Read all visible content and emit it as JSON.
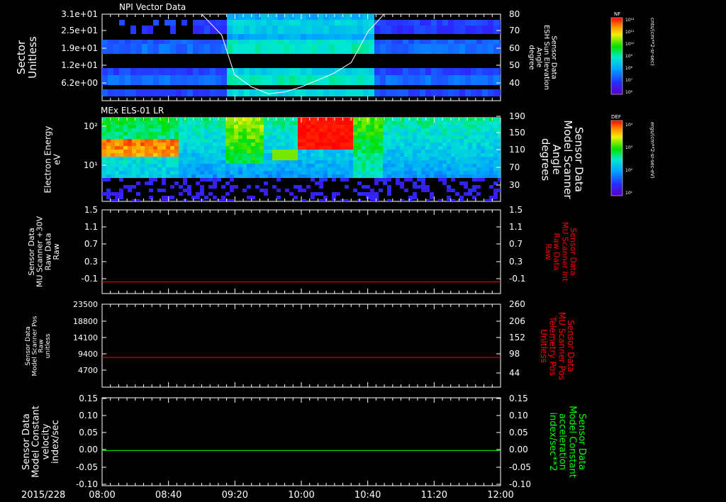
{
  "chart_data": [
    {
      "type": "heatmap",
      "title": "NPI Vector Data",
      "ylabel": [
        "Sector",
        "Unitless"
      ],
      "yticks": [
        "3.1e+01",
        "2.5e+01",
        "1.9e+01",
        "1.2e+01",
        "6.2e+00"
      ],
      "y2label": [
        "Sensor Data",
        "ESH Sun Elevation",
        "Angle",
        "degree"
      ],
      "y2lim": [
        30,
        80
      ],
      "y2ticks": [
        "40",
        "50",
        "60",
        "70",
        "80"
      ],
      "colorbar": {
        "label": "NF",
        "units": "cnts/(cm**2-sr-sec)",
        "ticks": [
          "10¹²",
          "10¹¹",
          "10¹⁰",
          "10⁹",
          "10⁸",
          "10⁷",
          "10⁶"
        ]
      },
      "series": [
        {
          "x": [
            8.0,
            8.33,
            8.67,
            9.0,
            9.2,
            9.33,
            9.5,
            9.67,
            9.83,
            10.0,
            10.17,
            10.33,
            10.5,
            10.67,
            10.83,
            11.0,
            11.5,
            12.0
          ],
          "y": [
            80,
            80,
            80,
            80,
            68,
            45,
            38,
            34,
            35,
            38,
            42,
            46,
            52,
            70,
            80,
            80,
            80,
            80
          ]
        }
      ]
    },
    {
      "type": "heatmap",
      "title": "MEx ELS-01 LR",
      "ylabel": [
        "Electron Energy",
        "eV"
      ],
      "yticks": [
        "10²",
        "10¹"
      ],
      "y2label": [
        "Sensor Data",
        "Model Scanner",
        "Angle",
        "degrees"
      ],
      "y2lim": [
        10,
        190
      ],
      "y2ticks": [
        "30",
        "70",
        "110",
        "150",
        "190"
      ],
      "colorbar": {
        "label": "DEF",
        "units": "ergs/(cm**2-sr-sec-eV)",
        "ticks": [
          "10⁴",
          "10³",
          "10²",
          "10¹"
        ]
      }
    },
    {
      "type": "line",
      "ylabel": [
        "Sensor Data",
        "MU Scanner +30V",
        "Raw Data",
        "Raw"
      ],
      "ylim": [
        -0.3,
        1.5
      ],
      "yticks": [
        "1.5",
        "1.1",
        "0.7",
        "0.3",
        "-0.1"
      ],
      "y2label": [
        "Sensor Data",
        "MU Scanner Int",
        "Raw Data",
        "Raw"
      ],
      "y2ticks": [
        "1.5",
        "1.1",
        "0.7",
        "0.3",
        "-0.1"
      ],
      "series": [
        {
          "color": "#ff0000",
          "x": [
            8,
            12
          ],
          "y": [
            -0.05,
            -0.05
          ]
        }
      ]
    },
    {
      "type": "line",
      "ylabel": [
        "Sensor Data",
        "Model Scanner Pos",
        "Raw",
        "unitless"
      ],
      "ylim": [
        0,
        23500
      ],
      "yticks": [
        "23500",
        "18800",
        "14100",
        "9400",
        "4700"
      ],
      "y2label": [
        "Sensor Data",
        "MU Scanner Pos",
        "Telemetry Pos",
        "Unitless"
      ],
      "y2ticks": [
        "260",
        "206",
        "152",
        "98",
        "44"
      ],
      "series": [
        {
          "color": "#ff0000",
          "x": [
            8,
            12
          ],
          "y": [
            8400,
            8400
          ]
        }
      ]
    },
    {
      "type": "line",
      "ylabel": [
        "Sensor Data",
        "Model Constant",
        "velocity",
        "index/sec"
      ],
      "ylim": [
        -0.1,
        0.15
      ],
      "yticks": [
        "0.15",
        "0.10",
        "0.05",
        "0.00",
        "-0.05",
        "-0.10"
      ],
      "y2label": [
        "Sensor Data",
        "Model Constant",
        "acceleration",
        "index/sec**2"
      ],
      "y2ticks": [
        "0.15",
        "0.10",
        "0.05",
        "0.00",
        "-0.05",
        "-0.10"
      ],
      "series": [
        {
          "color": "#00ff00",
          "x": [
            8,
            12
          ],
          "y": [
            0.0,
            0.0
          ]
        }
      ]
    }
  ],
  "xaxis": {
    "date": "2015/228",
    "ticks": [
      "08:00",
      "08:40",
      "09:20",
      "10:00",
      "10:40",
      "11:20",
      "12:00"
    ],
    "xlim": [
      8.0,
      12.0
    ]
  }
}
